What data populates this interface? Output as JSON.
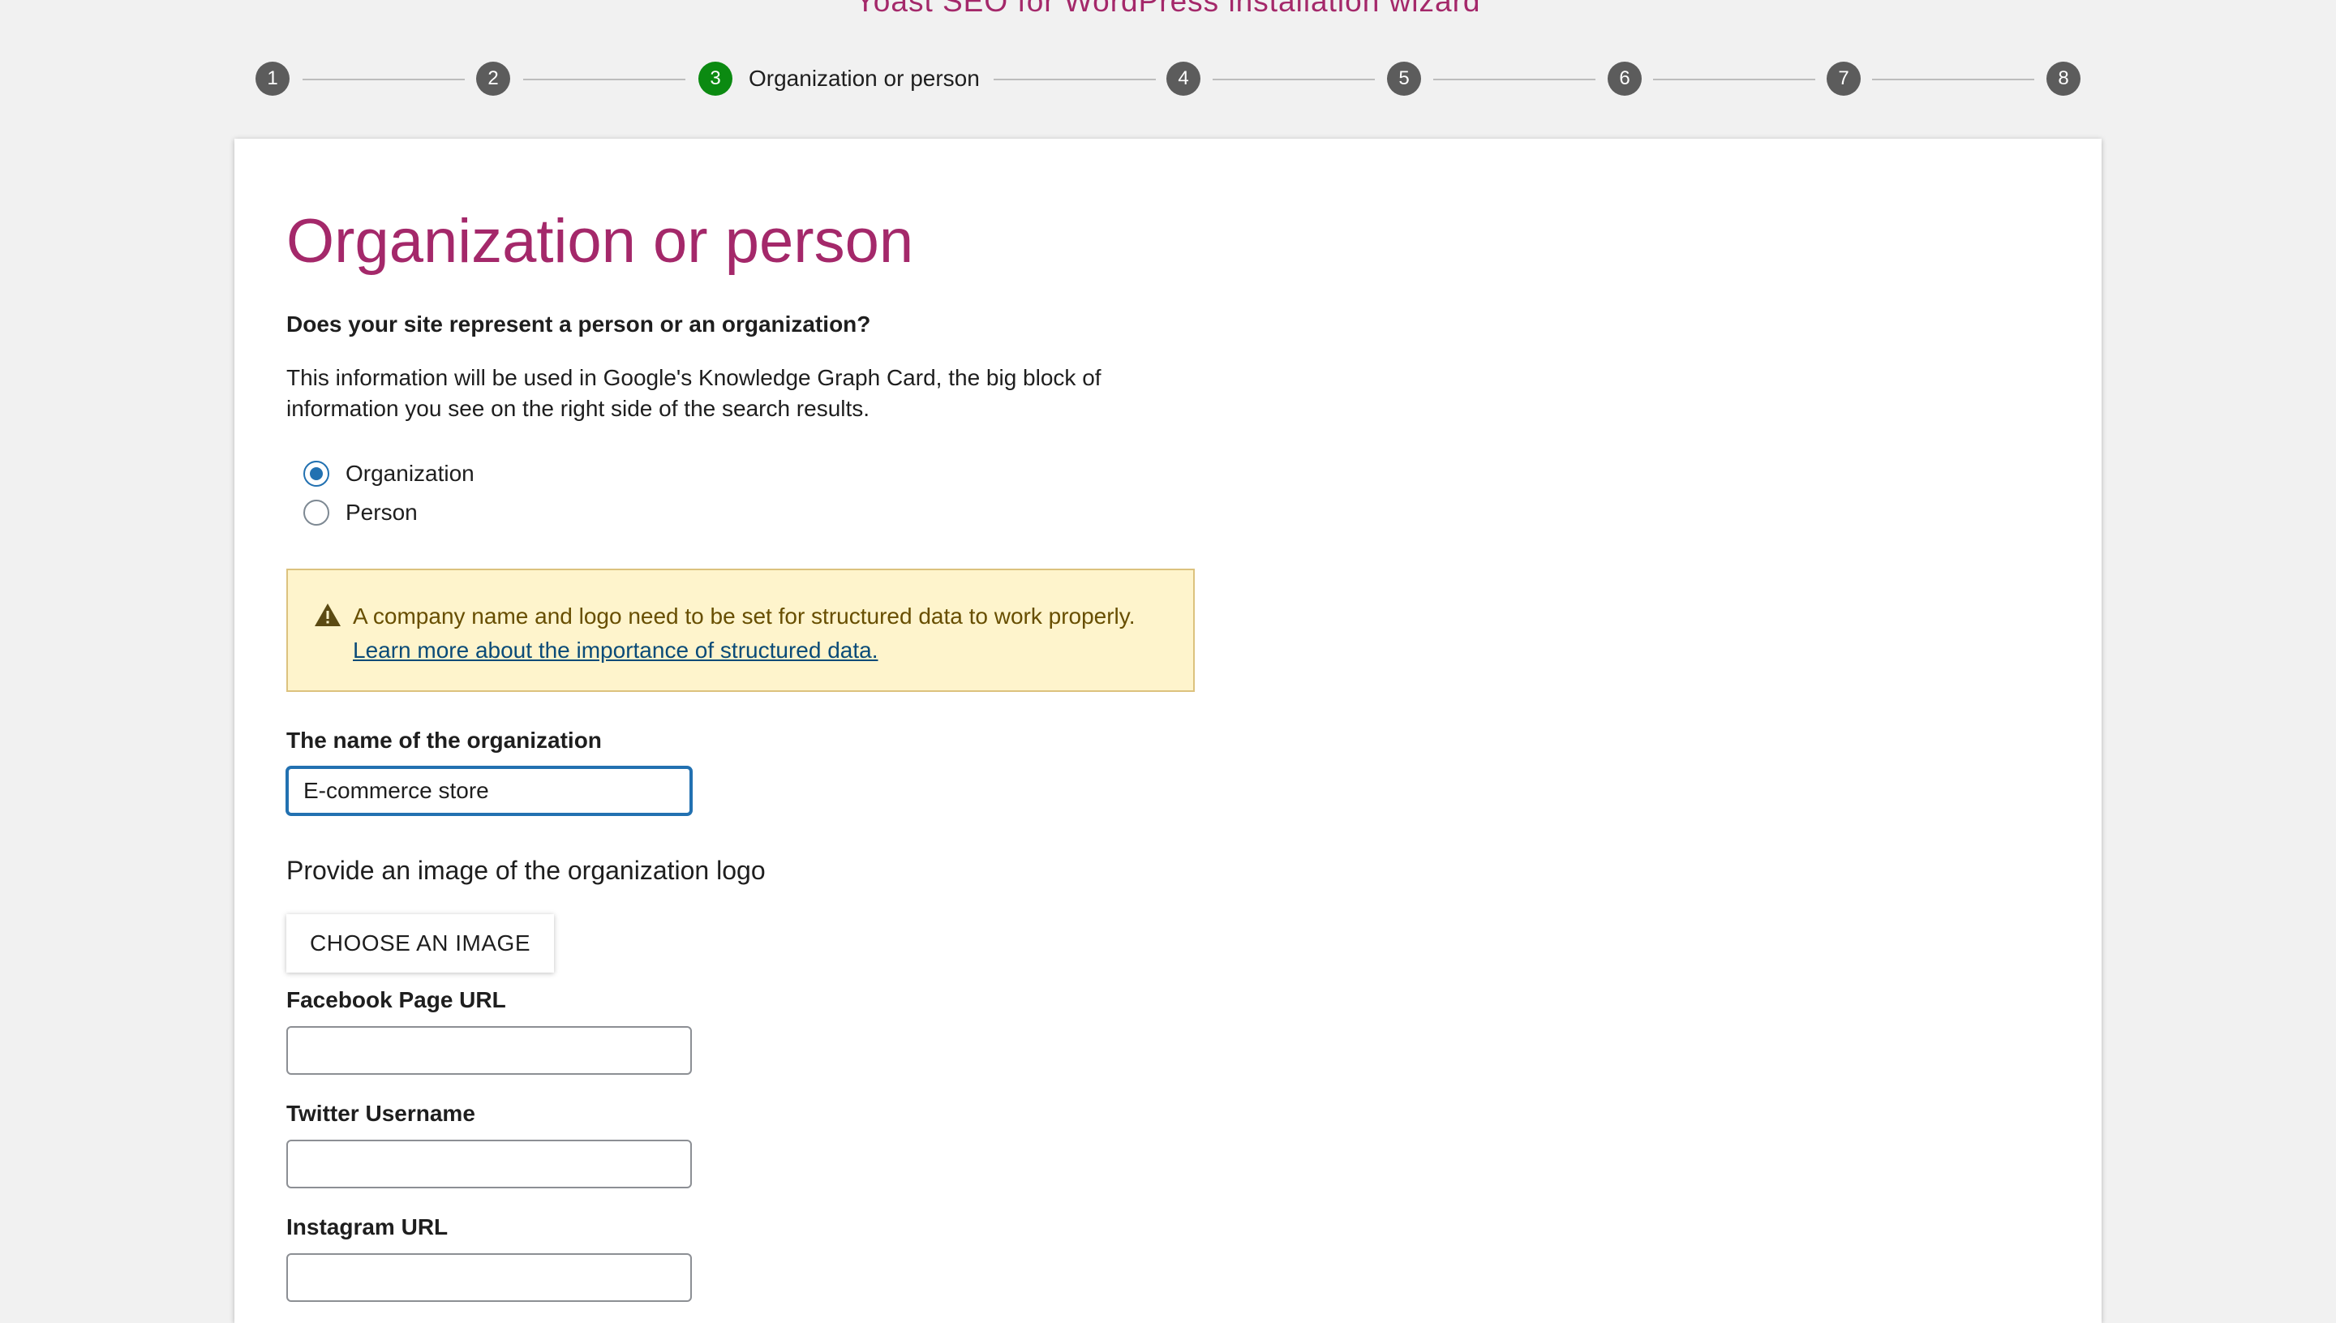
{
  "header": {
    "title": "Yoast SEO for WordPress installation wizard"
  },
  "steps": [
    {
      "number": "1"
    },
    {
      "number": "2"
    },
    {
      "number": "3",
      "label": "Organization or person",
      "active": true
    },
    {
      "number": "4"
    },
    {
      "number": "5"
    },
    {
      "number": "6"
    },
    {
      "number": "7"
    },
    {
      "number": "8"
    }
  ],
  "colors": {
    "brand": "#a4286a",
    "active_step": "#0b8a11",
    "step": "#5c5c5c",
    "focus": "#2271b1",
    "alert_bg": "#fef4cc"
  },
  "main": {
    "title": "Organization or person",
    "question": "Does your site represent a person or an organization?",
    "description": "This information will be used in Google's Knowledge Graph Card, the big block of information you see on the right side of the search results.",
    "options": [
      {
        "label": "Organization",
        "checked": true
      },
      {
        "label": "Person",
        "checked": false
      }
    ],
    "alert": {
      "icon": "warning-icon",
      "text": "A company name and logo need to be set for structured data to work properly.",
      "link": "Learn more about the importance of structured data."
    },
    "org_name": {
      "label": "The name of the organization",
      "value": "E-commerce store"
    },
    "logo": {
      "heading": "Provide an image of the organization logo",
      "button": "CHOOSE AN IMAGE"
    },
    "facebook": {
      "label": "Facebook Page URL",
      "value": ""
    },
    "twitter": {
      "label": "Twitter Username",
      "value": ""
    },
    "instagram": {
      "label": "Instagram URL",
      "value": ""
    }
  }
}
